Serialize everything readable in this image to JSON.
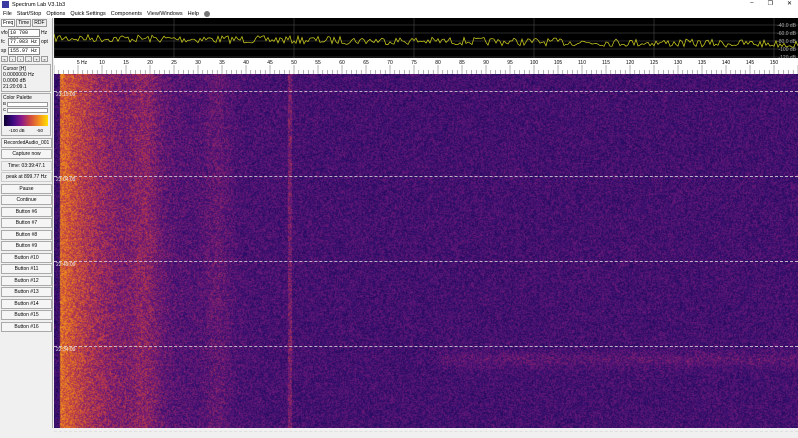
{
  "window": {
    "title": "Spectrum Lab V3.1b3",
    "min": "–",
    "restore": "❐",
    "close": "✕"
  },
  "menu": [
    "File",
    "Start/Stop",
    "Options",
    "Quick Settings",
    "Components",
    "View/Windows",
    "Help"
  ],
  "left": {
    "tabs": [
      "Freq",
      "Time",
      "RDF"
    ],
    "vfo": {
      "label": "vfo",
      "value": "10 700 000",
      "suffix": "Hz"
    },
    "fc": {
      "label": "fc",
      "value": "77.983 Hz",
      "suffix": "opt"
    },
    "sp": {
      "label": "sp",
      "value": "155.97 Hz"
    },
    "nav": [
      "«",
      "‹",
      "›",
      "-",
      "+",
      "»"
    ],
    "cursor": {
      "title": "Cursor [H]",
      "freq": "0.0000000 Hz",
      "level": "0.0000 dB",
      "time": "21:20:09.1"
    },
    "palette": {
      "title": "Color Palette",
      "b": "B",
      "c": "C",
      "min": "-100 dB",
      "max": "-50"
    },
    "buttons": [
      "RecordedAudio_001",
      "Capture now"
    ],
    "time": "Time:  03:39:47.1",
    "peak": "peak at 899.77 Hz",
    "buttons2": [
      "Pause",
      "Continue",
      "Button #6",
      "Button #7",
      "Button #8",
      "Button #9",
      "Button #10",
      "Button #11",
      "Button #12",
      "Button #13",
      "Button #14",
      "Button #15",
      "Button #16"
    ]
  },
  "spectrum": {
    "db_labels": [
      "-40.0 dB",
      "-60.0 dB",
      "-80.0 dB",
      "-100 dB",
      "-120 dB"
    ],
    "trace_color": "#d8d820"
  },
  "freq_scale": {
    "unit_label": "5 Hz",
    "ticks": [
      10,
      15,
      20,
      25,
      30,
      35,
      40,
      45,
      50,
      55,
      60,
      65,
      70,
      75,
      80,
      85,
      90,
      95,
      100,
      105,
      110,
      115,
      120,
      125,
      130,
      135,
      140,
      145,
      150
    ],
    "range_hz": [
      0,
      155
    ]
  },
  "waterfall": {
    "time_labels": [
      "23:19:09",
      "23:04:09",
      "22:49:09",
      "22:34:09",
      "22:19:09"
    ]
  }
}
